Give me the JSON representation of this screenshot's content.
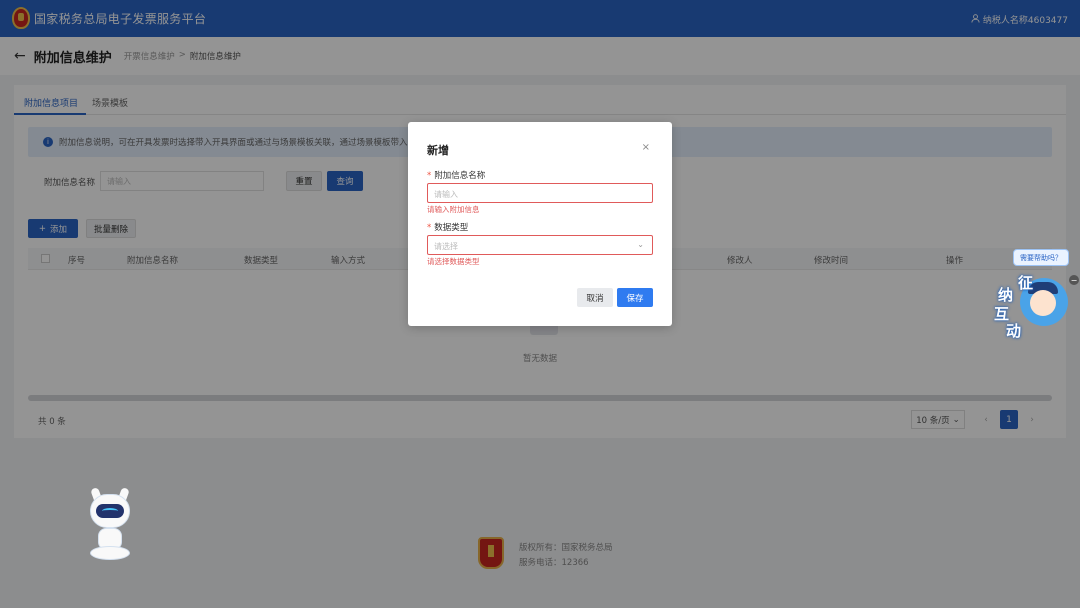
{
  "topbar": {
    "brand": "国家税务总局电子发票服务平台",
    "user": "纳税人名称4603477"
  },
  "header": {
    "back_icon": "←",
    "title": "附加信息维护",
    "breadcrumb": [
      "开票信息维护",
      "附加信息维护"
    ],
    "sep": ">"
  },
  "tabs": [
    {
      "label": "附加信息项目",
      "active": true
    },
    {
      "label": "场景模板",
      "active": false
    }
  ],
  "info": {
    "text": "附加信息说明，可在开具发票时选择带入开具界面或通过与场景模板关联，通过场景模板带入，"
  },
  "filter": {
    "label": "附加信息名称",
    "placeholder": "请输入",
    "reset_label": "重置",
    "query_label": "查询"
  },
  "actions": {
    "add_label": "添加",
    "batch_delete_label": "批量删除"
  },
  "table": {
    "columns": [
      "序号",
      "附加信息名称",
      "数据类型",
      "输入方式",
      "修改人",
      "修改时间",
      "操作"
    ],
    "rows": [],
    "empty_text": "暂无数据"
  },
  "pagination": {
    "total": "共 0 条",
    "page_size": "10 条/页",
    "current_page": "1"
  },
  "footer": {
    "copyright": "版权所有：国家税务总局",
    "hotline": "服务电话：12366"
  },
  "modal": {
    "title": "新增",
    "close": "×",
    "fields": [
      {
        "label": "附加信息名称",
        "placeholder": "请输入",
        "error": "请输入附加信息"
      },
      {
        "label": "数据类型",
        "placeholder": "请选择",
        "error": "请选择数据类型"
      }
    ],
    "cancel_label": "取消",
    "save_label": "保存"
  },
  "helper": {
    "bubble": "需要帮助吗？",
    "mascot_chars": [
      "征",
      "纳",
      "互",
      "动"
    ],
    "minimize": "−"
  },
  "colors": {
    "primary": "#2a64c5",
    "error": "#e05a5a",
    "info_bg": "#e3eefc"
  }
}
